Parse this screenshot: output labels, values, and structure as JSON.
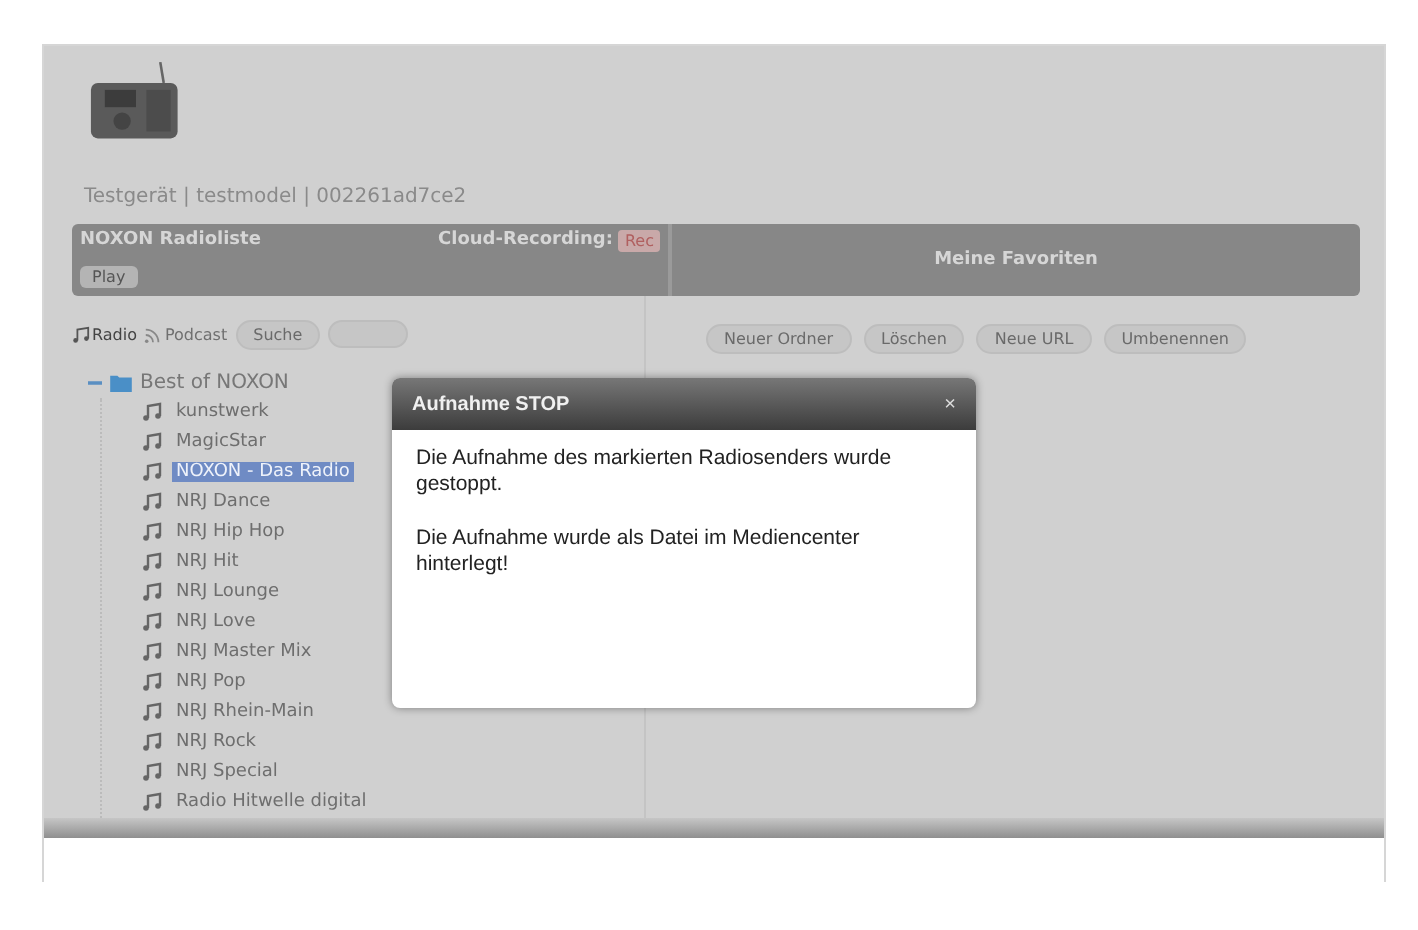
{
  "device": {
    "info": "Testgerät | testmodel | 002261ad7ce2"
  },
  "bar": {
    "list_title": "NOXON Radioliste",
    "play_button": "Play",
    "recording_label": "Cloud-Recording:",
    "rec_button": "Rec",
    "favorites_title": "Meine Favoriten"
  },
  "source_tabs": [
    {
      "label": "Radio",
      "kind": "radio",
      "selected": true
    },
    {
      "label": "Podcast",
      "kind": "podcast",
      "selected": false
    }
  ],
  "left_buttons": [
    "Suche"
  ],
  "tree": [
    {
      "label": "Best of NOXON",
      "expanded": true,
      "children": [
        {
          "label": "kunstwerk",
          "selected": false
        },
        {
          "label": "MagicStar",
          "selected": false
        },
        {
          "label": "NOXON - Das Radio",
          "selected": true
        },
        {
          "label": "NRJ Dance",
          "selected": false
        },
        {
          "label": "NRJ Hip Hop",
          "selected": false
        },
        {
          "label": "NRJ Hit",
          "selected": false
        },
        {
          "label": "NRJ Lounge",
          "selected": false
        },
        {
          "label": "NRJ Love",
          "selected": false
        },
        {
          "label": "NRJ Master Mix",
          "selected": false
        },
        {
          "label": "NRJ Pop",
          "selected": false
        },
        {
          "label": "NRJ Rhein-Main",
          "selected": false
        },
        {
          "label": "NRJ Rock",
          "selected": false
        },
        {
          "label": "NRJ Special",
          "selected": false
        },
        {
          "label": "Radio Hitwelle digital",
          "selected": false
        }
      ]
    }
  ],
  "favorites_buttons": [
    "Neuer Ordner",
    "Löschen",
    "Neue URL",
    "Umbenennen"
  ],
  "dialog": {
    "title": "Aufnahme STOP",
    "close": "×",
    "paragraphs": [
      "Die Aufnahme des markierten Radiosenders wurde gestoppt.",
      "Die Aufnahme wurde als Datei im Mediencenter hinterlegt!"
    ]
  }
}
